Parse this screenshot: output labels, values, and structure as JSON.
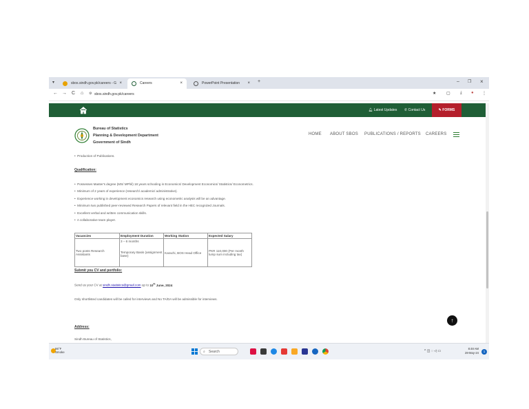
{
  "browser": {
    "tabs": [
      {
        "label": "sbos.sindh.gov.pk/careers - G",
        "close": "×"
      },
      {
        "label": "Careers",
        "close": "×"
      },
      {
        "label": "PowerPoint Presentation",
        "close": "×"
      }
    ],
    "new_tab": "+",
    "window_controls": {
      "minimize": "–",
      "restore": "❐",
      "close": "×"
    },
    "nav": {
      "back": "←",
      "forward": "→",
      "reload": "C",
      "home": "⌂"
    },
    "url": "sbos.sindh.gov.pk/careers",
    "toolbar_icons": [
      "★",
      "▢",
      "⤓",
      "●",
      "⋮"
    ]
  },
  "site": {
    "top_links": {
      "latest_updates": "Latest Updates",
      "contact_us": "Contact Us",
      "forms": "FORMS"
    },
    "org": {
      "line1": "Bureau of Statistics",
      "line2": "Planning & Development Department",
      "line3": "Government of Sindh"
    },
    "nav": [
      "HOME",
      "ABOUT SBOS",
      "PUBLICATIONS / REPORTS",
      "CAREERS"
    ],
    "content": {
      "prev_bullet": "Production of Publications.",
      "qualification_heading": "Qualification:",
      "qualifications": [
        "Possesses Master's degree (MS/ MPhil) 18 years schooling in Economics/ Development Economics/ Statistics/ Econometrics.",
        "Minimum of 2 years of experience (research/ academic/ administrative).",
        "Experience working in development economics research using econometric analysis will be an advantage.",
        "Minimum two published peer-reviewed Research Papers of relevant field in the HEC recognized Journals.",
        "Excellent verbal and written communication skills.",
        "A collaborative team player."
      ],
      "table": {
        "headers": [
          "Vacancies",
          "Employment Duration",
          "Working Station",
          "Expected Salary"
        ],
        "row": {
          "vacancies": "Two posts Research Assistants",
          "duration_1": "3 – 6 months",
          "duration_2": "Temporary Basis (assignment base)",
          "station": "Karachi, BOS Head Office",
          "salary": "PKR 110,000 (Per month lump sum including tax)"
        }
      },
      "submit_heading": "Submit you CV and portfolio:",
      "submit_prefix": "Send us your CV at ",
      "submit_email": "sindh.statistics@gmail.com",
      "submit_middle": " up to ",
      "submit_date_day": "10",
      "submit_date_sup": "th",
      "submit_date_rest": " June, 2024",
      "shortlist_note": "Only shortlisted candidates will be called for interviews and No TA/DA will be admissible for interviews.",
      "address_heading": "Address:",
      "address_line": "Sindh Bureau of Statistics,"
    },
    "scroll_top": "↑"
  },
  "taskbar": {
    "weather_temp": "86°F",
    "weather_desc": "Smoke",
    "search_placeholder": "Search",
    "time": "8:48 AM",
    "date": "28-May-24",
    "notification": "1"
  },
  "colors": {
    "site_green": "#1f5e36",
    "forms_red": "#b41f2b",
    "hamburger_green": "#2e7d32"
  }
}
